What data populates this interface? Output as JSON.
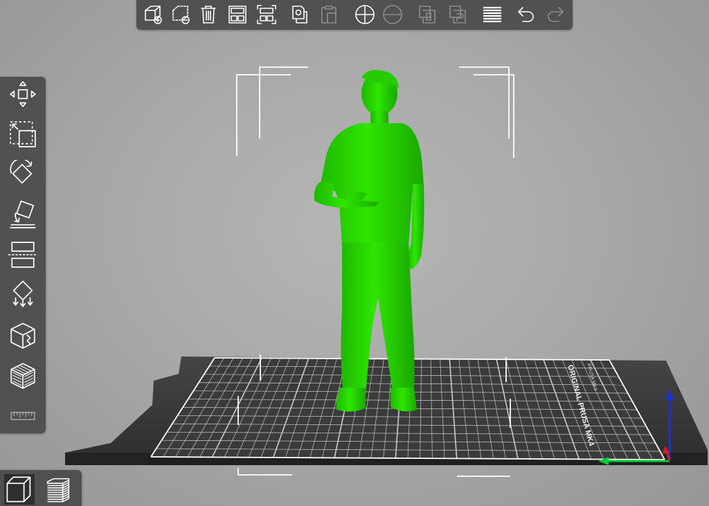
{
  "app": {
    "colors": {
      "toolbar_bg": "#464646",
      "icon": "#ffffff",
      "model": "#22dd00",
      "bed": "#3a3a3a",
      "grid": "#ffffff",
      "axis_x": "#00cc33",
      "axis_y": "#cc2222",
      "axis_z": "#1a33cc"
    }
  },
  "top_toolbar": {
    "items": [
      {
        "name": "add-object-icon",
        "enabled": true
      },
      {
        "name": "delete-selected-icon",
        "enabled": true
      },
      {
        "name": "trash-icon",
        "enabled": true
      },
      {
        "name": "arrange-icon",
        "enabled": true
      },
      {
        "name": "arrange-selection-icon",
        "enabled": true
      },
      {
        "name": "copy-icon",
        "enabled": true
      },
      {
        "name": "paste-icon",
        "enabled": false
      },
      {
        "name": "add-instance-icon",
        "enabled": true
      },
      {
        "name": "remove-instance-icon",
        "enabled": false
      },
      {
        "name": "split-objects-icon",
        "enabled": false
      },
      {
        "name": "split-parts-icon",
        "enabled": false
      },
      {
        "name": "layers-icon",
        "enabled": true
      },
      {
        "name": "undo-icon",
        "enabled": true
      },
      {
        "name": "redo-icon",
        "enabled": false
      }
    ]
  },
  "left_toolbar": {
    "items": [
      {
        "name": "move-icon"
      },
      {
        "name": "scale-icon"
      },
      {
        "name": "rotate-icon"
      },
      {
        "name": "place-on-face-icon"
      },
      {
        "name": "cut-icon"
      },
      {
        "name": "support-paint-icon"
      },
      {
        "name": "seam-paint-icon"
      },
      {
        "name": "mmu-paint-icon"
      },
      {
        "name": "measure-icon"
      }
    ]
  },
  "bottom_toolbar": {
    "items": [
      {
        "name": "3d-view-icon",
        "active": true
      },
      {
        "name": "preview-layers-icon",
        "active": false
      }
    ]
  },
  "bed": {
    "label": "ORIGINAL PRUSA MK4",
    "sublabel": "PRUSA MK4"
  }
}
